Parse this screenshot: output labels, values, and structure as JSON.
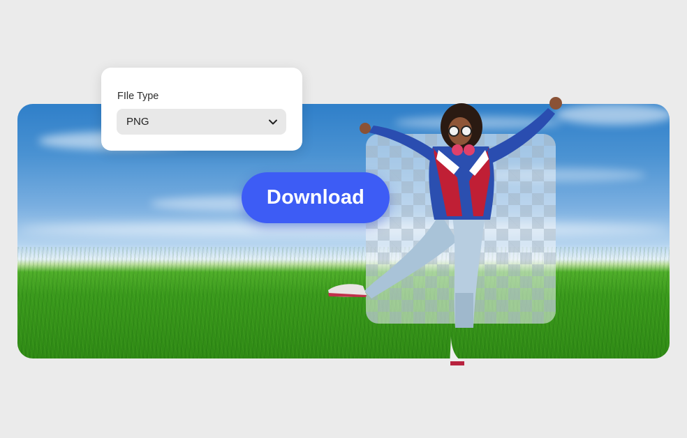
{
  "file_type": {
    "label": "FIle Type",
    "selected": "PNG"
  },
  "download_button": {
    "label": "Download"
  },
  "colors": {
    "page_background": "#ebebeb",
    "button_accent": "#3d5cf5",
    "panel_background": "#ffffff",
    "select_background": "#e8e8e8"
  },
  "icons": {
    "dropdown": "chevron-down-icon"
  }
}
